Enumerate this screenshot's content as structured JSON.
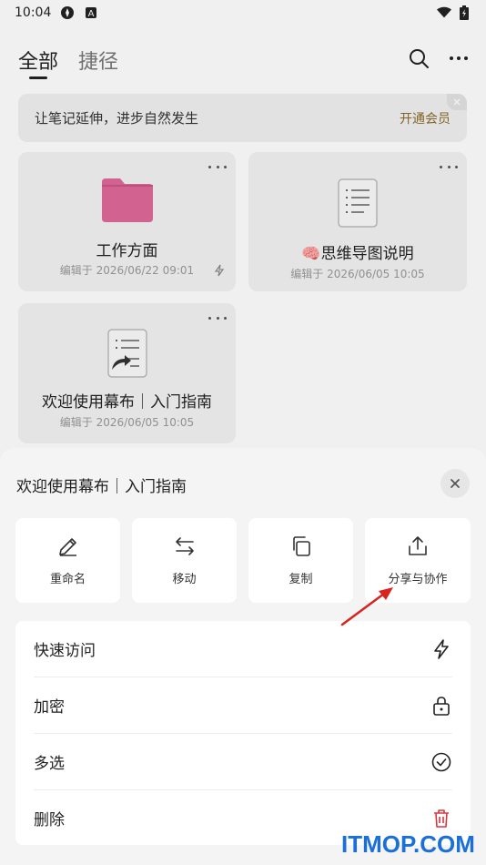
{
  "status_bar": {
    "time": "10:04"
  },
  "header": {
    "tab_all": "全部",
    "tab_shortcut": "捷径"
  },
  "promo": {
    "text": "让笔记延伸，进步自然发生",
    "action": "开通会员"
  },
  "cards": [
    {
      "title": "工作方面",
      "meta": "编辑于 2026/06/22 09:01",
      "icon": "folder-icon"
    },
    {
      "title": "🧠思维导图说明",
      "meta": "编辑于 2026/06/05 10:05",
      "icon": "document-icon"
    },
    {
      "title": "欢迎使用幕布｜入门指南",
      "meta": "编辑于 2026/06/05 10:05",
      "icon": "shared-document-icon"
    }
  ],
  "sheet": {
    "title": "欢迎使用幕布｜入门指南",
    "actions": [
      {
        "label": "重命名",
        "icon": "pencil-icon"
      },
      {
        "label": "移动",
        "icon": "move-arrows-icon"
      },
      {
        "label": "复制",
        "icon": "copy-icon"
      },
      {
        "label": "分享与协作",
        "icon": "share-icon"
      }
    ],
    "list": [
      {
        "label": "快速访问",
        "icon": "lightning-icon"
      },
      {
        "label": "加密",
        "icon": "lock-icon"
      },
      {
        "label": "多选",
        "icon": "check-circle-icon"
      },
      {
        "label": "删除",
        "icon": "trash-icon"
      }
    ]
  },
  "colors": {
    "folder": "#e0699a",
    "delete": "#d9363e",
    "watermark": "#1a6fd8",
    "promo_action": "#8a6a2a"
  },
  "watermark": "ITMOP.COM"
}
